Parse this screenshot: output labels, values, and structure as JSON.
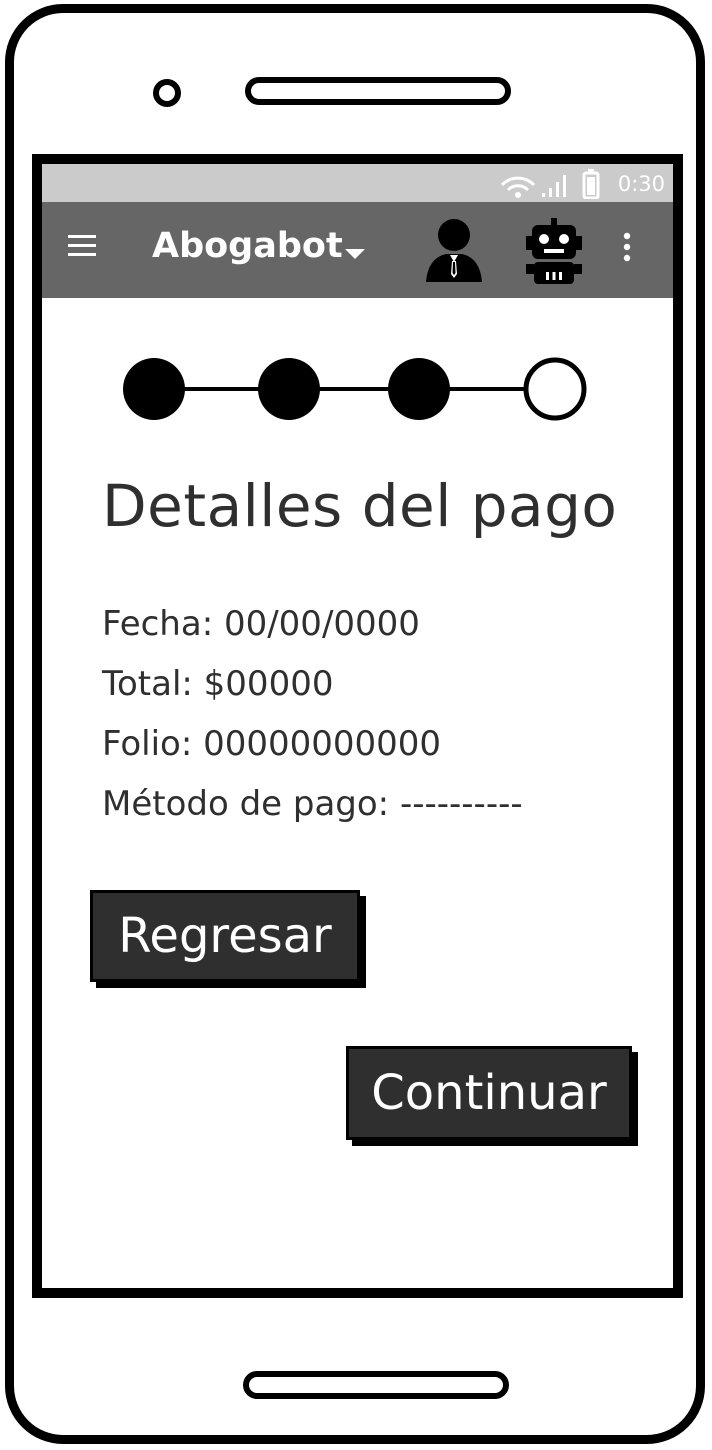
{
  "status_bar": {
    "time": "0:30"
  },
  "app_bar": {
    "title": "Abogabot",
    "icons": [
      "menu-icon",
      "chevron-down-icon",
      "user-icon",
      "robot-icon",
      "more-vert-icon"
    ]
  },
  "stepper": {
    "total_steps": 4,
    "completed_steps": 3
  },
  "page": {
    "title": "Detalles del pago",
    "details": [
      "Fecha: 00/00/0000",
      "Total: $00000",
      "Folio: 00000000000",
      "Método de pago: ----------"
    ]
  },
  "buttons": {
    "back_label": "Regresar",
    "continue_label": "Continuar"
  },
  "colors": {
    "app_bar": "#666666",
    "status_bar": "#cbcbcb",
    "button": "#2f2f2f",
    "text": "#2f2f2f"
  }
}
